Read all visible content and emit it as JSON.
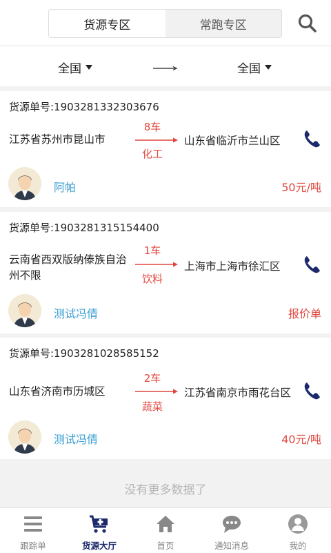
{
  "header": {
    "tabs": [
      {
        "label": "货源专区",
        "active": true
      },
      {
        "label": "常跑专区",
        "active": false
      }
    ],
    "search_icon": "search-icon"
  },
  "filter": {
    "from": "全国",
    "to": "全国"
  },
  "cargo": [
    {
      "no": "货源单号:1903281332303676",
      "from": "江苏省苏州市昆山市",
      "count": "8车",
      "goods": "化工",
      "to": "山东省临沂市兰山区",
      "name": "阿帕",
      "price": "50元/吨"
    },
    {
      "no": "货源单号:1903281315154400",
      "from": "云南省西双版纳傣族自治州不限",
      "count": "1车",
      "goods": "饮料",
      "to": "上海市上海市徐汇区",
      "name": "测试冯倩",
      "price": "报价单"
    },
    {
      "no": "货源单号:1903281028585152",
      "from": "山东省济南市历城区",
      "count": "2车",
      "goods": "蔬菜",
      "to": "江苏省南京市雨花台区",
      "name": "测试冯倩",
      "price": "40元/吨"
    }
  ],
  "footer_text": "没有更多数据了",
  "tabbar": [
    {
      "label": "跟踪单",
      "icon": "menu-icon",
      "active": false
    },
    {
      "label": "货源大厅",
      "icon": "cart-plus-icon",
      "active": true
    },
    {
      "label": "首页",
      "icon": "home-icon",
      "active": false
    },
    {
      "label": "通知消息",
      "icon": "chat-icon",
      "active": false
    },
    {
      "label": "我的",
      "icon": "user-icon",
      "active": false
    }
  ],
  "colors": {
    "accent_red": "#e0473e",
    "name_blue": "#3d9fd3",
    "dark_navy": "#1c2a6b"
  }
}
